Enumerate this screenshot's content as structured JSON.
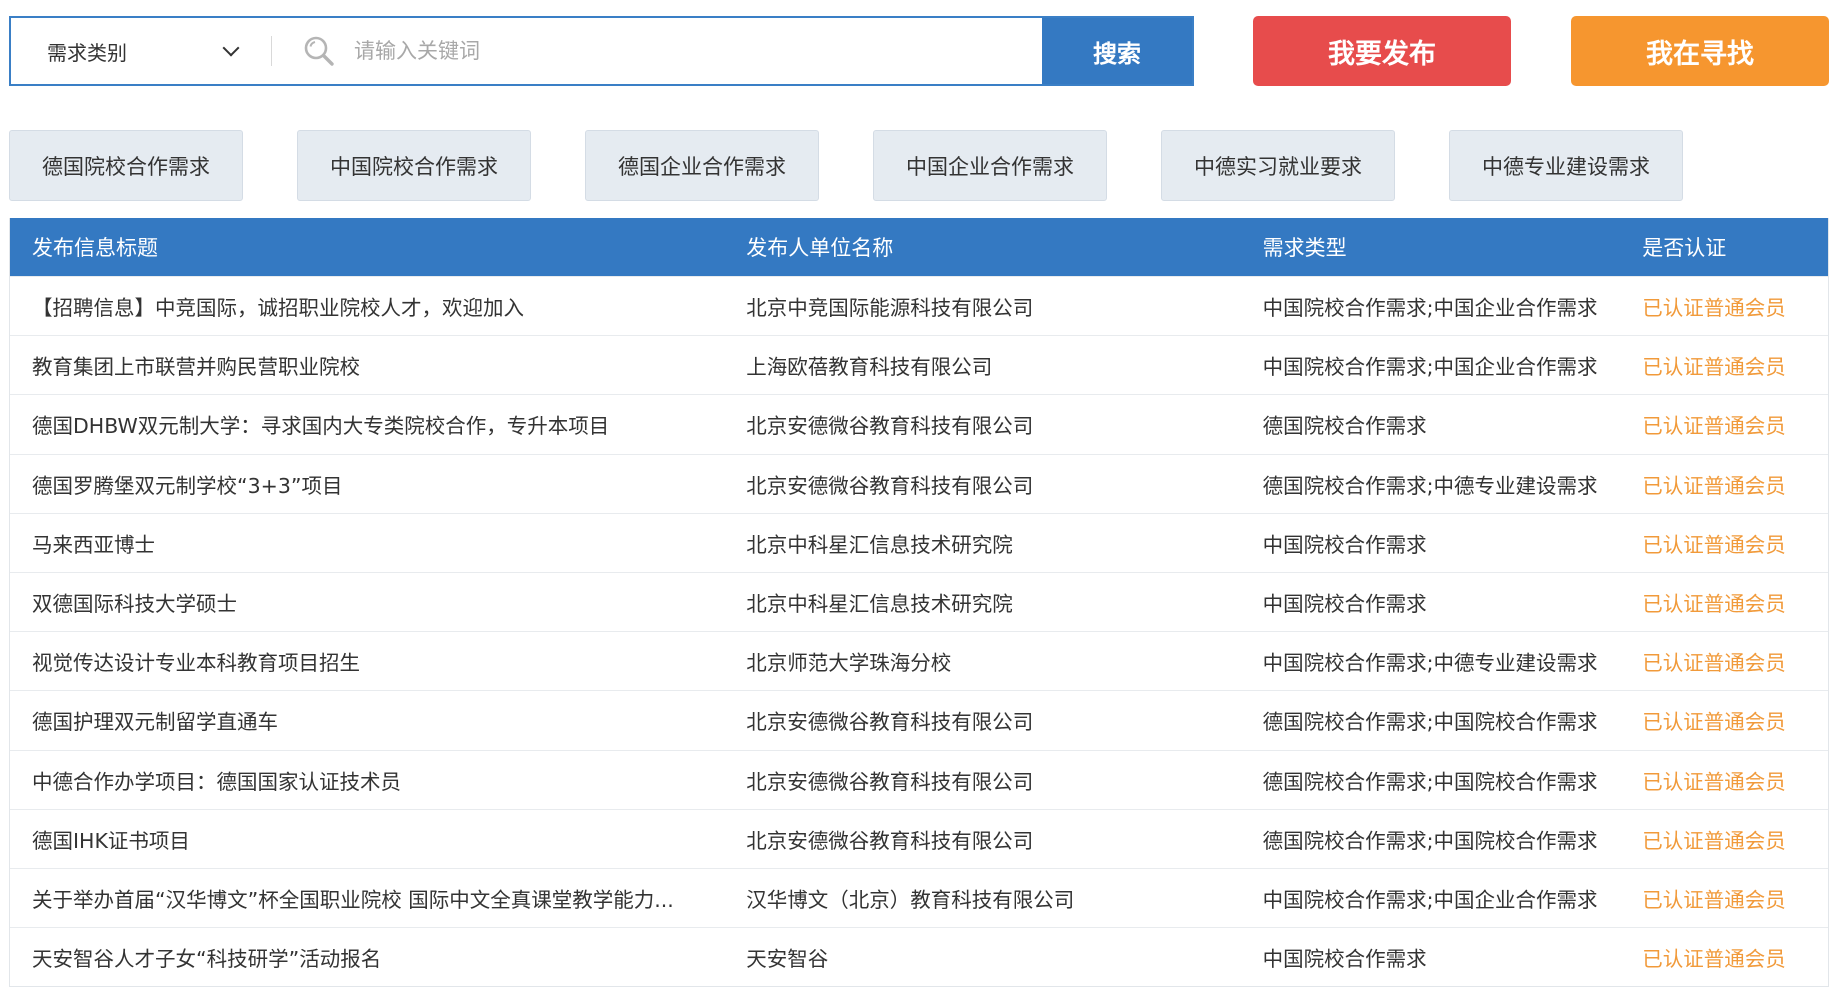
{
  "search": {
    "category_label": "需求类别",
    "placeholder": "请输入关键词",
    "value": "",
    "button_label": "搜索"
  },
  "actions": {
    "publish_label": "我要发布",
    "seek_label": "我在寻找"
  },
  "tabs": [
    {
      "label": "德国院校合作需求"
    },
    {
      "label": "中国院校合作需求"
    },
    {
      "label": "德国企业合作需求"
    },
    {
      "label": "中国企业合作需求"
    },
    {
      "label": "中德实习就业要求"
    },
    {
      "label": "中德专业建设需求"
    }
  ],
  "table": {
    "headers": [
      "发布信息标题",
      "发布人单位名称",
      "需求类型",
      "是否认证"
    ],
    "rows": [
      [
        "【招聘信息】中竞国际，诚招职业院校人才，欢迎加入",
        "北京中竞国际能源科技有限公司",
        "中国院校合作需求;中国企业合作需求",
        "已认证普通会员"
      ],
      [
        "教育集团上市联营并购民营职业院校",
        "上海欧蓓教育科技有限公司",
        "中国院校合作需求;中国企业合作需求",
        "已认证普通会员"
      ],
      [
        "德国DHBW双元制大学：寻求国内大专类院校合作，专升本项目",
        "北京安德微谷教育科技有限公司",
        "德国院校合作需求",
        "已认证普通会员"
      ],
      [
        "德国罗腾堡双元制学校“3+3”项目",
        "北京安德微谷教育科技有限公司",
        "德国院校合作需求;中德专业建设需求",
        "已认证普通会员"
      ],
      [
        "马来西亚博士",
        "北京中科星汇信息技术研究院",
        "中国院校合作需求",
        "已认证普通会员"
      ],
      [
        "双德国际科技大学硕士",
        "北京中科星汇信息技术研究院",
        "中国院校合作需求",
        "已认证普通会员"
      ],
      [
        "视觉传达设计专业本科教育项目招生",
        "北京师范大学珠海分校",
        "中国院校合作需求;中德专业建设需求",
        "已认证普通会员"
      ],
      [
        "德国护理双元制留学直通车",
        "北京安德微谷教育科技有限公司",
        "德国院校合作需求;中国院校合作需求",
        "已认证普通会员"
      ],
      [
        "中德合作办学项目：德国国家认证技术员",
        "北京安德微谷教育科技有限公司",
        "德国院校合作需求;中国院校合作需求",
        "已认证普通会员"
      ],
      [
        "德国IHK证书项目",
        "北京安德微谷教育科技有限公司",
        "德国院校合作需求;中国院校合作需求",
        "已认证普通会员"
      ],
      [
        "关于举办首届“汉华博文”杯全国职业院校 国际中文全真课堂教学能力...",
        "汉华博文（北京）教育科技有限公司",
        "中国院校合作需求;中国企业合作需求",
        "已认证普通会员"
      ],
      [
        "天安智谷人才子女“科技研学”活动报名",
        "天安智谷",
        "中国院校合作需求",
        "已认证普通会员"
      ]
    ]
  },
  "colors": {
    "primary": "#3479c2",
    "publish": "#e74c4c",
    "seek": "#f6962f",
    "certified": "#f19a3a",
    "tab_bg": "#e5ebf1"
  },
  "icons": {
    "search": "search-icon",
    "dropdown": "chevron-down-icon"
  }
}
